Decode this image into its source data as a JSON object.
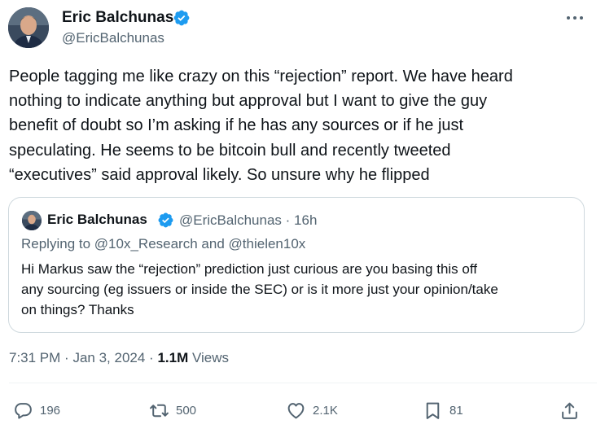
{
  "author": {
    "name": "Eric Balchunas",
    "handle": "@EricBalchunas"
  },
  "tweet": {
    "text": "People tagging me like crazy on this “rejection” report. We have heard\nnothing to indicate anything but approval but I want to give the guy\nbenefit of doubt so I’m asking if he has any sources or if he just\nspeculating. He seems to be bitcoin bull and recently tweeted\n“executives” said approval likely. So unsure why he flipped"
  },
  "quote": {
    "name": "Eric Balchunas",
    "meta": "@EricBalchunas · 16h",
    "replying_prefix": "Replying to",
    "mention_1": "@10x_Research",
    "and_word": "and",
    "mention_2": "@thielen10x",
    "text": "Hi Markus saw the “rejection” prediction just curious are you basing this off\nany sourcing (eg issuers or inside the SEC) or is it more just your opinion/take\non things? Thanks"
  },
  "meta": {
    "time": "7:31 PM",
    "separator": "·",
    "date": "Jan 3, 2024",
    "views_count": "1.1M",
    "views_label": "Views"
  },
  "actions": {
    "replies": "196",
    "reposts": "500",
    "likes": "2.1K",
    "bookmarks": "81"
  },
  "icons": {
    "verified": "verified-badge-icon",
    "more": "more-icon",
    "reply": "reply-icon",
    "repost": "repost-icon",
    "like": "heart-icon",
    "bookmark": "bookmark-icon",
    "share": "share-icon"
  },
  "colors": {
    "verified": "#1d9bf0",
    "text": "#0f1419",
    "muted": "#536471",
    "border": "#cfd9de"
  }
}
